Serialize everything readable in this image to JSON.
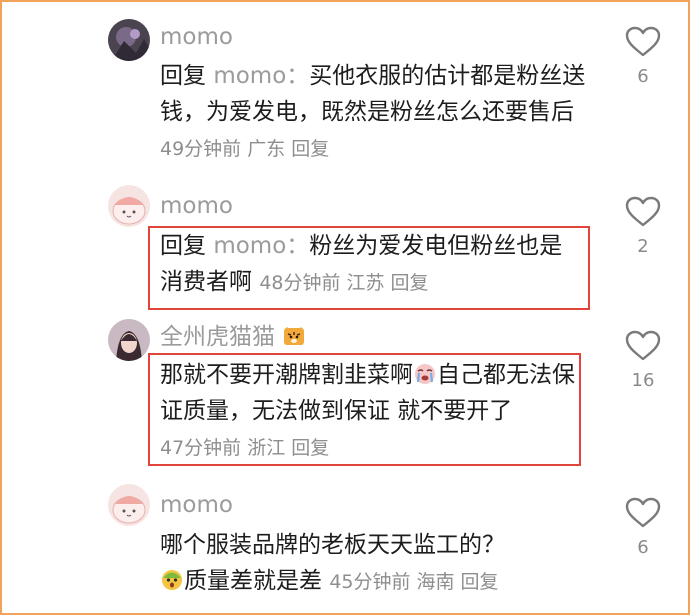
{
  "comments": [
    {
      "username": "momo",
      "reply_prefix": "回复",
      "reply_target": "momo：",
      "text": "买他衣服的估计都是粉丝送钱，为爱发电，既然是粉丝怎么还要售后",
      "time": "49分钟前",
      "location": "广东",
      "reply_label": "回复",
      "likes": "6",
      "avatar": "dark-avatar"
    },
    {
      "username": "momo",
      "reply_prefix": "回复",
      "reply_target": "momo：",
      "text": "粉丝为爱发电但粉丝也是消费者啊",
      "time": "48分钟前",
      "location": "江苏",
      "reply_label": "回复",
      "likes": "2",
      "avatar": "pink-cartoon-avatar"
    },
    {
      "username": "全州虎猫猫",
      "username_emoji": "tiger-emoji",
      "text_part1": "那就不要开潮牌割韭菜啊",
      "text_emoji": "crying-face-emoji",
      "text_part2": "自己都无法保证质量，无法做到保证 就不要开了",
      "time": "47分钟前",
      "location": "浙江",
      "reply_label": "回复",
      "likes": "16",
      "avatar": "photo-avatar"
    },
    {
      "username": "momo",
      "text_part1": "哪个服装品牌的老板天天监工的？",
      "text_emoji": "shocked-face-emoji",
      "text_part2": "质量差就是差",
      "time": "45分钟前",
      "location": "海南",
      "reply_label": "回复",
      "likes": "6",
      "avatar": "pink-cartoon-avatar"
    }
  ],
  "colors": {
    "frame_border": "#f2a35b",
    "highlight_box": "#e0453c",
    "meta_text": "#8e8e8e",
    "username_text": "#9b9b9b"
  }
}
